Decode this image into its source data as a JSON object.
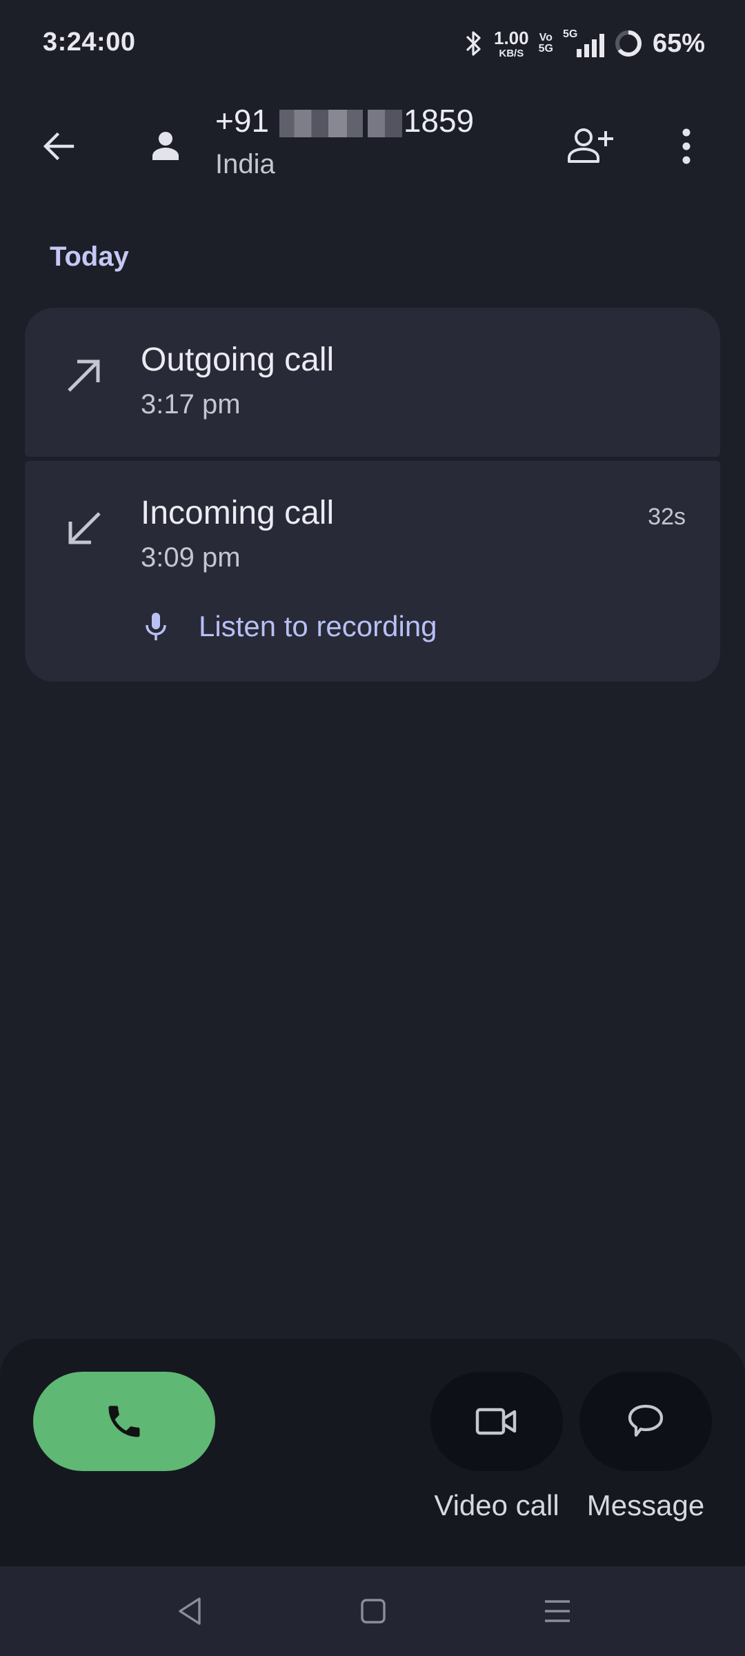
{
  "status_bar": {
    "time": "3:24:00",
    "net_speed_value": "1.00",
    "net_speed_unit": "KB/S",
    "volte_top": "Vo",
    "volte_bottom": "5G",
    "network": "5G",
    "battery_percent": "65%",
    "battery_level": 0.65
  },
  "header": {
    "number_prefix": "+91",
    "number_suffix": "1859",
    "country": "India"
  },
  "section": {
    "label": "Today"
  },
  "calls": [
    {
      "type": "Outgoing call",
      "time": "3:17 pm",
      "duration": ""
    },
    {
      "type": "Incoming call",
      "time": "3:09 pm",
      "duration": "32s",
      "recording_label": "Listen to recording"
    }
  ],
  "actions": {
    "video_label": "Video call",
    "message_label": "Message"
  },
  "colors": {
    "background": "#1c1e28",
    "card": "#282a37",
    "accent_green": "#5fb874",
    "accent_lavender": "#c5c8f4"
  }
}
